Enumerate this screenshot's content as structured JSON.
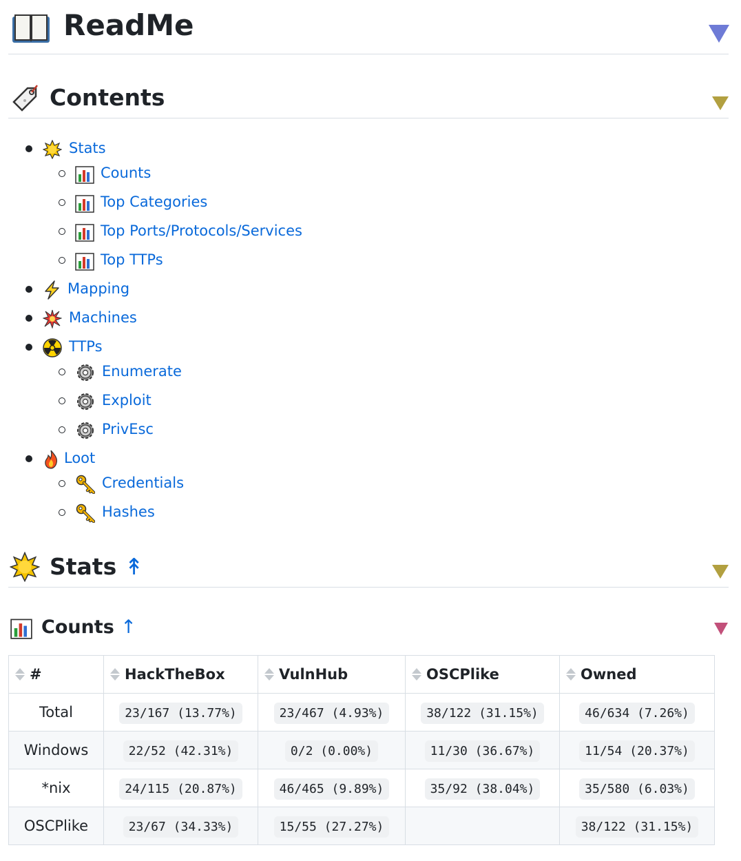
{
  "readme": {
    "title": "ReadMe",
    "icon": "open-book-icon",
    "toggle_color": "#6e7bd6"
  },
  "contents": {
    "title": "Contents",
    "icon": "bookmark-tag-icon",
    "toggle_color": "#b2a040"
  },
  "toc": {
    "stats": {
      "label": "Stats",
      "icon": "sun-icon"
    },
    "counts": {
      "label": "Counts",
      "icon": "bar-chart-icon"
    },
    "top_categories": {
      "label": "Top Categories",
      "icon": "bar-chart-icon"
    },
    "top_ports": {
      "label": "Top Ports/Protocols/Services",
      "icon": "bar-chart-icon"
    },
    "top_ttps": {
      "label": "Top TTPs",
      "icon": "bar-chart-icon"
    },
    "mapping": {
      "label": "Mapping",
      "icon": "lightning-icon"
    },
    "machines": {
      "label": "Machines",
      "icon": "explosion-icon"
    },
    "ttps": {
      "label": "TTPs",
      "icon": "radioactive-icon"
    },
    "enumerate": {
      "label": "Enumerate",
      "icon": "gear-icon"
    },
    "exploit": {
      "label": "Exploit",
      "icon": "gear-icon"
    },
    "privesc": {
      "label": "PrivEsc",
      "icon": "gear-icon"
    },
    "loot": {
      "label": "Loot",
      "icon": "fire-icon"
    },
    "credentials": {
      "label": "Credentials",
      "icon": "key-icon"
    },
    "hashes": {
      "label": "Hashes",
      "icon": "key-icon"
    }
  },
  "stats_section": {
    "title": "Stats",
    "back_arrow": "↟",
    "toggle_color": "#b2a040"
  },
  "counts_section": {
    "title": "Counts",
    "back_arrow": "↑",
    "toggle_color": "#c2507a"
  },
  "table": {
    "headers": [
      "#",
      "HackTheBox",
      "VulnHub",
      "OSCPlike",
      "Owned"
    ],
    "rows": [
      {
        "label": "Total",
        "cells": [
          "23/167 (13.77%)",
          "23/467 (4.93%)",
          "38/122 (31.15%)",
          "46/634 (7.26%)"
        ]
      },
      {
        "label": "Windows",
        "cells": [
          "22/52 (42.31%)",
          "0/2 (0.00%)",
          "11/30 (36.67%)",
          "11/54 (20.37%)"
        ]
      },
      {
        "label": "*nix",
        "cells": [
          "24/115 (20.87%)",
          "46/465 (9.89%)",
          "35/92 (38.04%)",
          "35/580 (6.03%)"
        ]
      },
      {
        "label": "OSCPlike",
        "cells": [
          "23/67 (34.33%)",
          "15/55 (27.27%)",
          "",
          "38/122 (31.15%)"
        ]
      }
    ]
  }
}
